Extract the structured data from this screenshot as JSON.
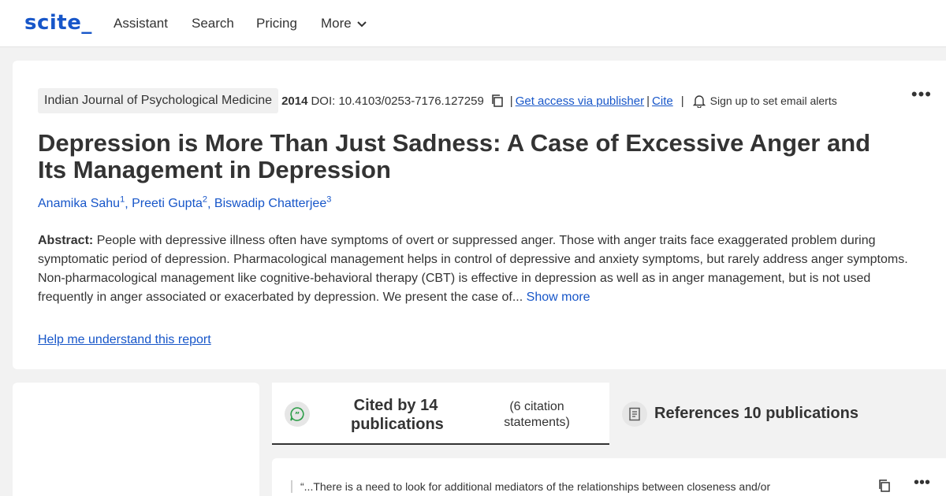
{
  "header": {
    "logo": "scite_",
    "nav": [
      "Assistant",
      "Search",
      "Pricing",
      "More"
    ]
  },
  "article": {
    "journal": "Indian Journal of Psychological Medicine",
    "year": "2014",
    "doi": "DOI: 10.4103/0253-7176.127259",
    "access_link": "Get access via publisher",
    "cite_link": "Cite",
    "alert_label": "Sign up to set email alerts",
    "title": "Depression is More Than Just Sadness: A Case of Excessive Anger and Its Management in Depression",
    "authors": [
      {
        "name": "Anamika Sahu",
        "sup": "1"
      },
      {
        "name": "Preeti Gupta",
        "sup": "2"
      },
      {
        "name": "Biswadip Chatterjee",
        "sup": "3"
      }
    ],
    "abstract_label": "Abstract:",
    "abstract_text": "People with depressive illness often have symptoms of overt or suppressed anger. Those with anger traits face exaggerated problem during symptomatic period of depression. Pharmacological management helps in control of depressive and anxiety symptoms, but rarely address anger symptoms. Non-pharmacological management like cognitive-behavioral therapy (CBT) is effective in depression as well as in anger management, but is not used frequently in anger associated or exacerbated by depression. We present the case of...",
    "show_more": "Show more",
    "help_link": "Help me understand this report"
  },
  "tabs": {
    "cited_title": "Cited by 14 publications",
    "cited_sub": "(6 citation statements)",
    "refs_title": "References 10 publications"
  },
  "statement": {
    "quote": "“...There is a need to look for additional mediators of the relationships between closeness and/or"
  },
  "colors": {
    "brand": "#1756c9",
    "icon_green": "#2e9e4a"
  }
}
